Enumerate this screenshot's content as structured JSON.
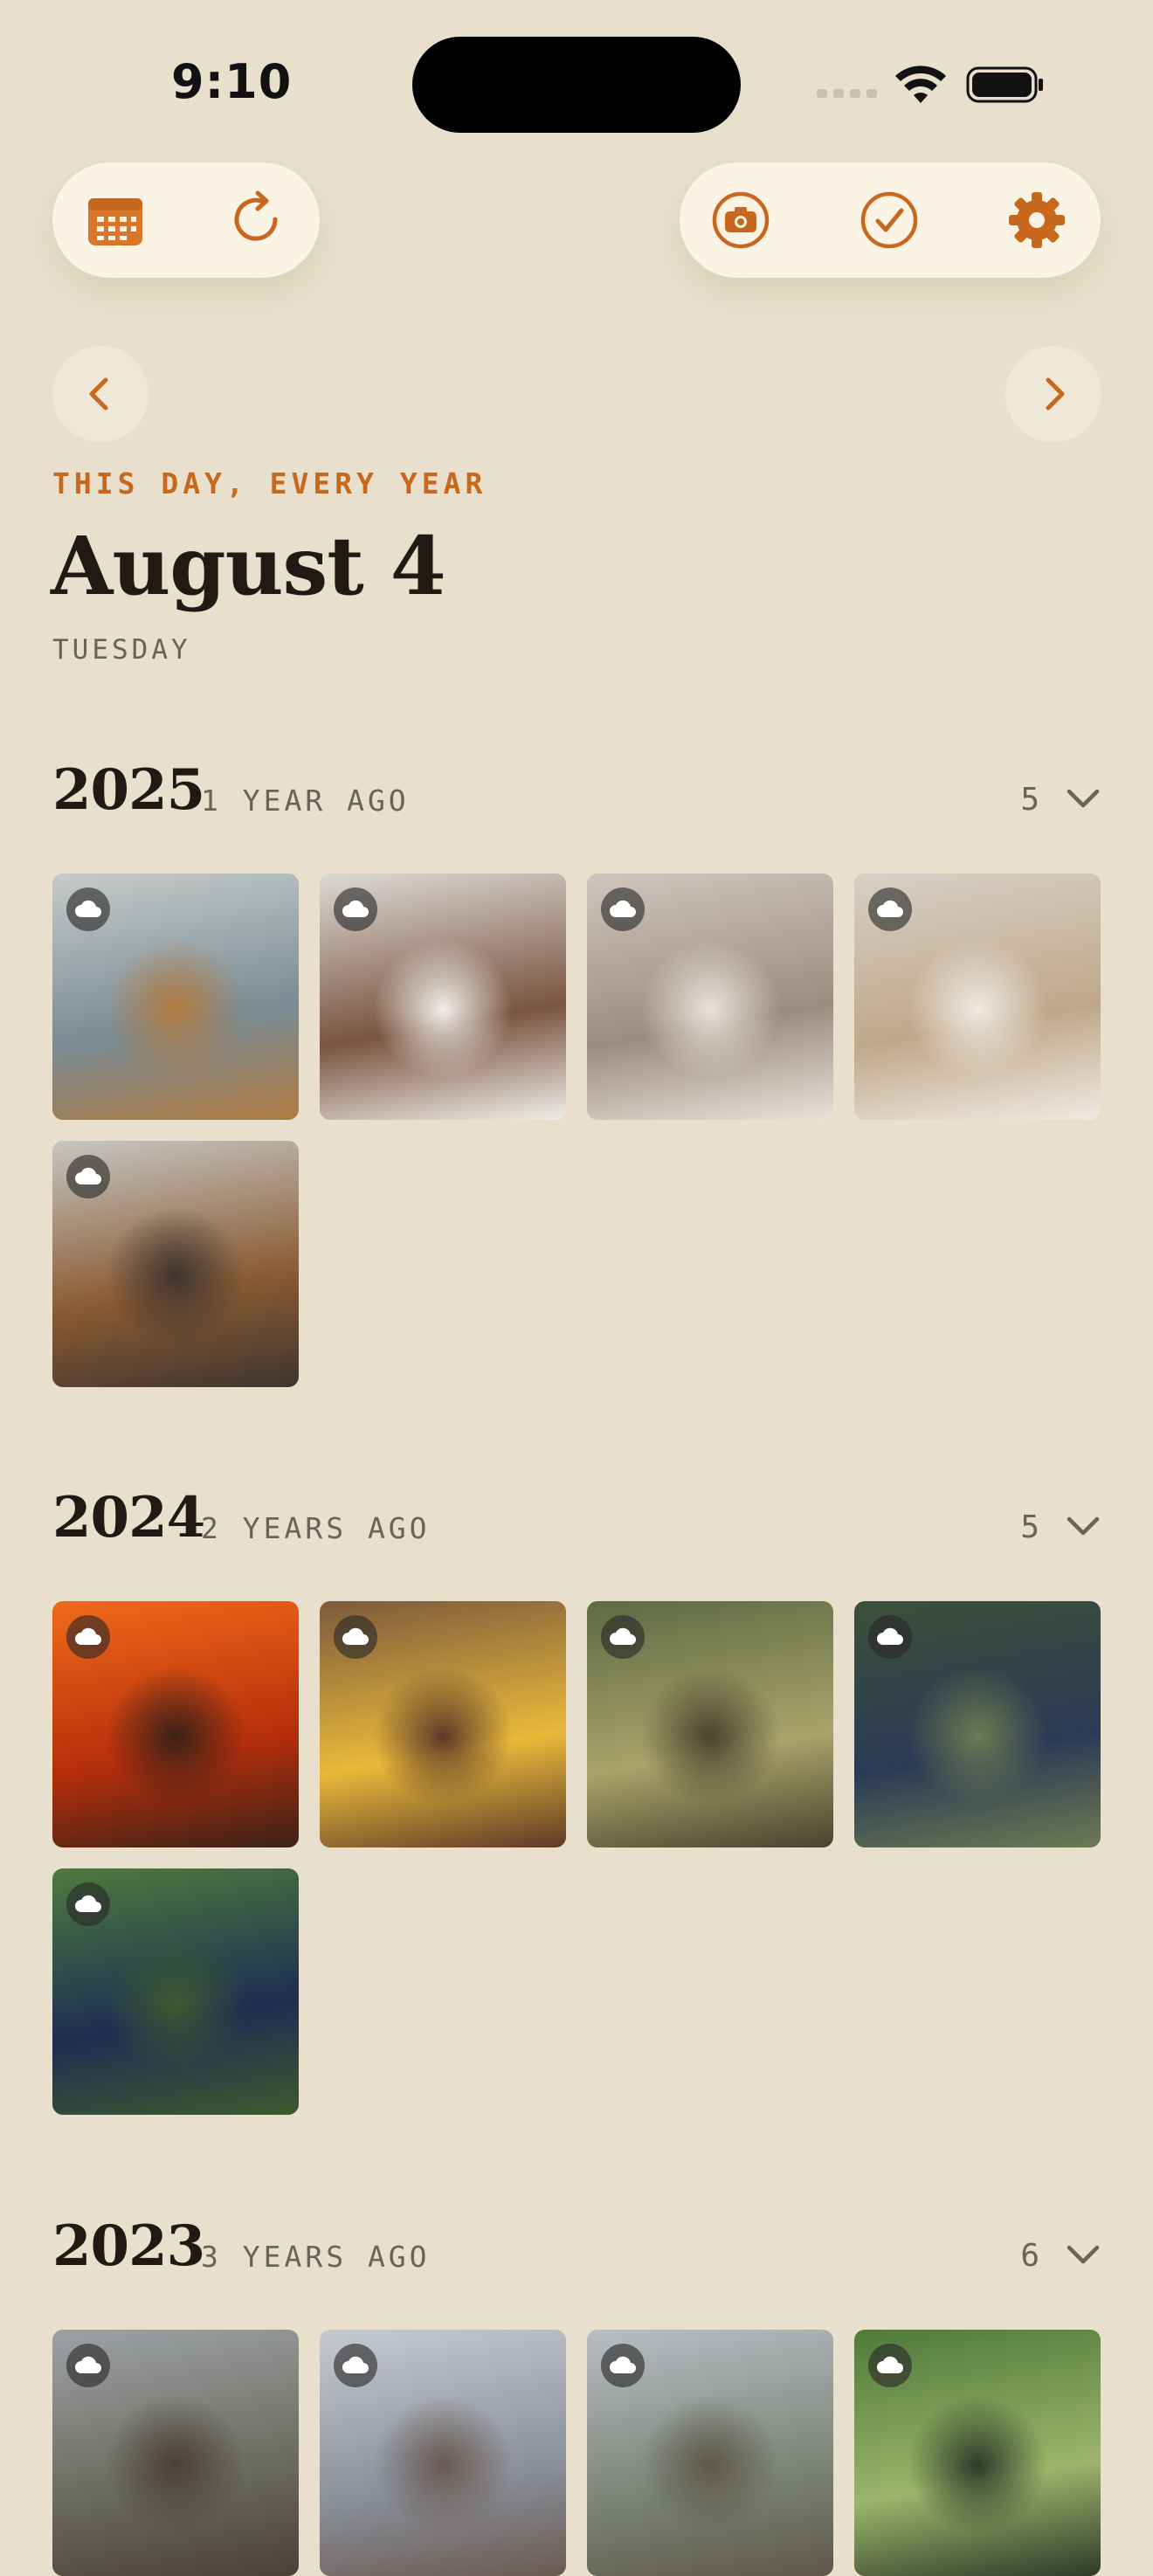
{
  "status_bar": {
    "time": "9:10"
  },
  "toolbar": {
    "left": [
      {
        "name": "calendar-button",
        "icon": "calendar-icon"
      },
      {
        "name": "refresh-button",
        "icon": "refresh-icon"
      }
    ],
    "right": [
      {
        "name": "camera-button",
        "icon": "camera-icon"
      },
      {
        "name": "checkmark-button",
        "icon": "checkmark-circle-icon"
      },
      {
        "name": "settings-button",
        "icon": "gear-icon"
      }
    ],
    "accent": "#c8681e"
  },
  "header": {
    "eyebrow": "THIS DAY, EVERY YEAR",
    "date": "August 4",
    "weekday": "TUESDAY"
  },
  "years": [
    {
      "year": "2025",
      "ago": "1 YEAR AGO",
      "count": "5",
      "photos": [
        {
          "subject": "dog on grey bed",
          "colors": [
            "#c7cbc9",
            "#7a8b93",
            "#b07a40"
          ]
        },
        {
          "subject": "brown curly dog on bed",
          "colors": [
            "#dcdad6",
            "#7a5440",
            "#efeeea"
          ]
        },
        {
          "subject": "pug in blanket",
          "colors": [
            "#cfc6bd",
            "#9c8c80",
            "#e8e2da"
          ]
        },
        {
          "subject": "pug on couch",
          "colors": [
            "#d7d0c6",
            "#bfa78a",
            "#efeae2"
          ]
        },
        {
          "subject": "golden retriever on bed",
          "colors": [
            "#c6c6c2",
            "#8a5a32",
            "#3e3530"
          ]
        }
      ]
    },
    {
      "year": "2024",
      "ago": "2 YEARS AGO",
      "count": "5",
      "photos": [
        {
          "subject": "grill fire",
          "colors": [
            "#f06a1a",
            "#b52e0b",
            "#3a2218"
          ]
        },
        {
          "subject": "picnic table drinks",
          "colors": [
            "#7c5a3c",
            "#e9b93a",
            "#5c3a28"
          ]
        },
        {
          "subject": "backyard fence",
          "colors": [
            "#5d6a44",
            "#a9a36a",
            "#48432f"
          ]
        },
        {
          "subject": "person grilling",
          "colors": [
            "#3d4f3a",
            "#2b3a55",
            "#6d7a52"
          ]
        },
        {
          "subject": "smoker grill in forest",
          "colors": [
            "#4e7a3e",
            "#1e2e52",
            "#3c5a2e"
          ]
        }
      ]
    },
    {
      "year": "2023",
      "ago": "3 YEARS AGO",
      "count": "6",
      "photos": [
        {
          "subject": "hikers on ridge",
          "colors": [
            "#9ea2a6",
            "#6a6a5e",
            "#4a4038"
          ]
        },
        {
          "subject": "hikers overlook",
          "colors": [
            "#c6cad0",
            "#8a909a",
            "#6a5a52"
          ]
        },
        {
          "subject": "pair on summit",
          "colors": [
            "#b8bec4",
            "#7c8478",
            "#5e584a"
          ]
        },
        {
          "subject": "friends on green hills",
          "colors": [
            "#4e7a3a",
            "#9cb46a",
            "#2e3a2a"
          ]
        }
      ]
    }
  ]
}
